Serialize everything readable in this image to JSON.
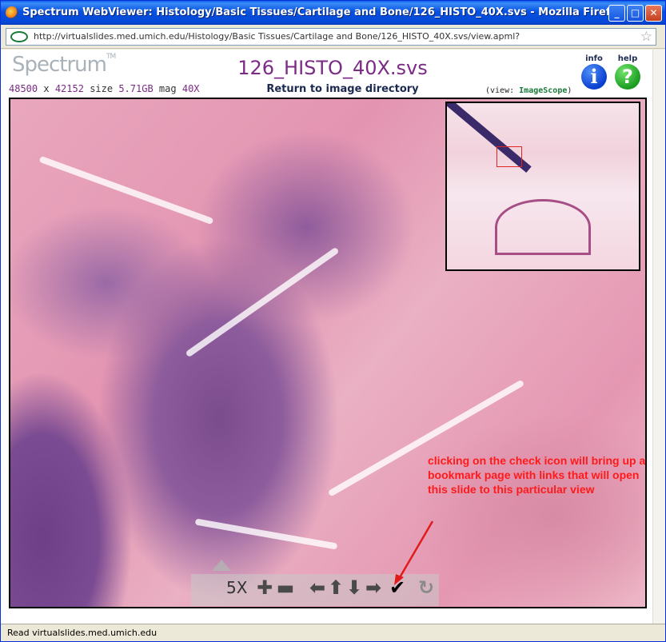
{
  "window": {
    "title": "Spectrum WebViewer: Histology/Basic Tissues/Cartilage and Bone/126_HISTO_40X.svs - Mozilla Firefox",
    "minimize": "_",
    "maximize": "□",
    "close": "✕"
  },
  "address": {
    "url": "http://virtualslides.med.umich.edu/Histology/Basic Tissues/Cartilage and Bone/126_HISTO_40X.svs/view.apml?"
  },
  "page": {
    "logo": "Spectrum",
    "logo_tm": "TM",
    "file_title": "126_HISTO_40X.svs",
    "width_px": "48500",
    "times": "x",
    "height_px": "42152",
    "size_label": "size",
    "size_value": "5.71GB",
    "mag_label": "mag",
    "mag_value": "40X",
    "return_link": "Return to image directory",
    "view_prefix": "(view:",
    "view_link": "ImageScope",
    "view_suffix": ")",
    "info_label": "info",
    "info_glyph": "i",
    "help_label": "help",
    "help_glyph": "?"
  },
  "viewer": {
    "zoom": "5X",
    "zoom_in": "✚",
    "zoom_out": "▬",
    "pan_left": "⬅",
    "pan_up": "⬆",
    "pan_down": "⬇",
    "pan_right": "➡",
    "bookmark": "✔",
    "reset": "↻"
  },
  "annotation": {
    "text": "clicking on the check icon will bring up a bookmark page with links that will open this slide to this particular view",
    "color": "#ff1a1a"
  },
  "status": {
    "text": "Read virtualslides.med.umich.edu"
  },
  "colors": {
    "title_purple": "#7b2a86",
    "titlebar_blue": "#0548d8"
  }
}
